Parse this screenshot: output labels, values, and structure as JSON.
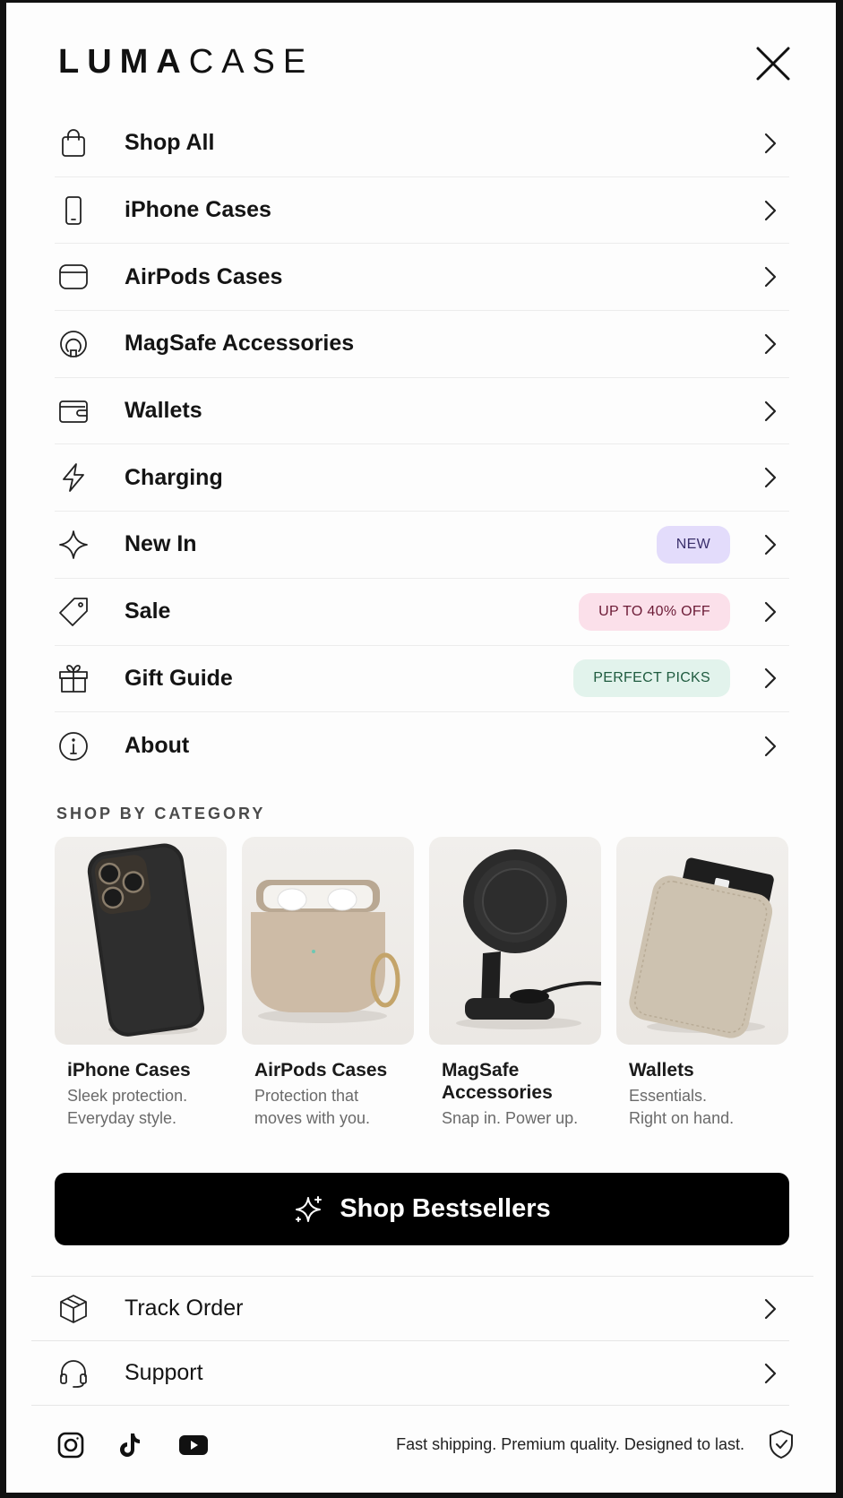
{
  "brand": {
    "bold": "LUMA",
    "light": "CASE"
  },
  "menu": [
    {
      "label": "Shop All",
      "icon": "bag-icon"
    },
    {
      "label": "iPhone Cases",
      "icon": "phone-icon"
    },
    {
      "label": "AirPods Cases",
      "icon": "airpods-case-icon"
    },
    {
      "label": "MagSafe Accessories",
      "icon": "magsafe-icon"
    },
    {
      "label": "Wallets",
      "icon": "wallet-icon"
    },
    {
      "label": "Charging",
      "icon": "bolt-icon"
    },
    {
      "label": "New In",
      "icon": "sparkle-icon",
      "badge": "NEW",
      "badge_bg": "#e3dcfb",
      "badge_fg": "#3a2f6b"
    },
    {
      "label": "Sale",
      "icon": "tag-icon",
      "badge": "UP TO 40% OFF",
      "badge_bg": "#fbe0ea",
      "badge_fg": "#6b1a35"
    },
    {
      "label": "Gift Guide",
      "icon": "gift-icon",
      "badge": "PERFECT PICKS",
      "badge_bg": "#e2f3ec",
      "badge_fg": "#1f5b3f"
    },
    {
      "label": "About",
      "icon": "info-icon"
    }
  ],
  "category_section": {
    "title": "SHOP BY CATEGORY",
    "items": [
      {
        "title": "iPhone Cases",
        "subtitle": "Sleek protection.\nEveryday style."
      },
      {
        "title": "AirPods Cases",
        "subtitle": "Protection that\nmoves with you."
      },
      {
        "title": "MagSafe Accessories",
        "subtitle": "Snap in. Power up."
      },
      {
        "title": "Wallets",
        "subtitle": "Essentials.\nRight on hand."
      }
    ]
  },
  "cta": {
    "label": "Shop Bestsellers"
  },
  "bottom_links": [
    {
      "label": "Track Order",
      "icon": "box-icon"
    },
    {
      "label": "Support",
      "icon": "headset-icon"
    }
  ],
  "footer": {
    "tagline": "Fast shipping. Premium quality. Designed to last.",
    "socials": [
      "instagram-icon",
      "tiktok-icon",
      "youtube-icon"
    ]
  }
}
